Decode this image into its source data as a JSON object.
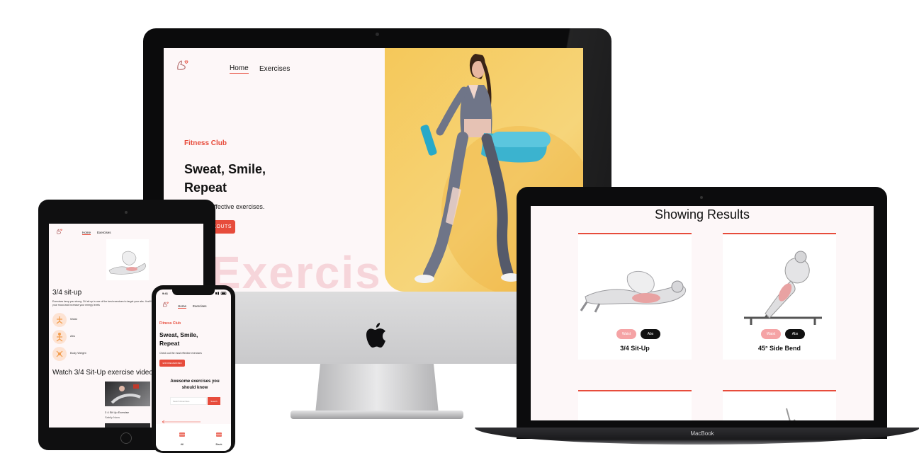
{
  "colors": {
    "accent": "#e74c3c",
    "page_bg": "#fdf7f8",
    "hero_bg": "#f5c85a"
  },
  "imac": {
    "nav": {
      "logo_icon": "flexed-arm-heart-icon",
      "home": "Home",
      "exercises": "Exercises"
    },
    "hero": {
      "kicker": "Fitness Club",
      "title": "Sweat, Smile, Repeat",
      "subtitle": "the most effective exercises.",
      "button": "RKOUTS",
      "watermark": "Exercis"
    }
  },
  "laptop": {
    "heading": "Showing Results",
    "brand": "MacBook",
    "cards": [
      {
        "name": "3/4 Sit-Up",
        "tag_a": "Waist",
        "tag_b": "Abs"
      },
      {
        "name": "45° Side Bend",
        "tag_a": "Waist",
        "tag_b": "Abs"
      }
    ]
  },
  "tablet": {
    "nav": {
      "home": "Home",
      "exercises": "Exercises"
    },
    "exercise_title": "3/4 sit-up",
    "description": "Exercises keep you strong. 3/4 sit up is one of the best exercises to target your abs. It will help you improve your mood and increase your energy levels",
    "details": [
      {
        "icon": "body-part-icon",
        "label": "Waist"
      },
      {
        "icon": "target-icon",
        "label": "Abs"
      },
      {
        "icon": "equipment-icon",
        "label": "Body Weight"
      }
    ],
    "videos_heading": "Watch 3/4 Sit-Up exercise videos",
    "video": {
      "title": "3 4 Sit Up Exercise",
      "channel": "Sabily Nora"
    }
  },
  "phone": {
    "time": "9:41",
    "nav": {
      "home": "Home",
      "exercises": "Exercises"
    },
    "hero": {
      "kicker": "Fitness Club",
      "title": "Sweat, Smile, Repeat",
      "subtitle": "Check out the most effective exercises",
      "button": "EXPLORE EXERCISES"
    },
    "section_title": "Awesome exercises you should know",
    "search": {
      "placeholder": "Search Exercises",
      "button": "Search"
    },
    "tabbar": [
      {
        "label": "All"
      },
      {
        "label": "Back"
      }
    ]
  }
}
